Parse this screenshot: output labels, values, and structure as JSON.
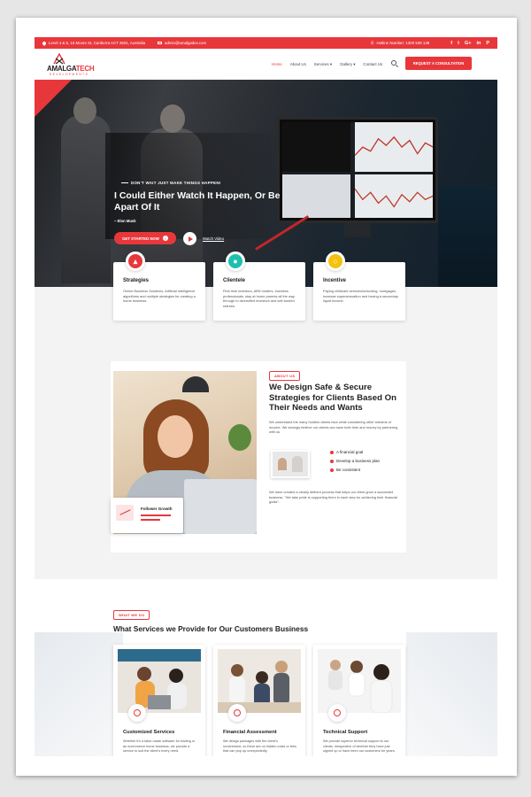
{
  "topbar": {
    "address": "Level 4 & 5, 15 Moore St, Canberra ACT 2601, Australia",
    "email": "admin@amalgadev.com",
    "phone": "Hotline Number: 1300 539 138",
    "social": [
      "f",
      "t",
      "G+",
      "in",
      "P"
    ]
  },
  "logo": {
    "name_a": "AMALGA",
    "name_b": "TECH",
    "sub": "DEVELOPMENTS"
  },
  "nav": {
    "items": [
      "Home",
      "About Us",
      "Services",
      "Gallery",
      "Contact Us"
    ],
    "active": "Home",
    "cta": "REQUEST A CONSULTATION"
  },
  "hero": {
    "tagline": "DON'T WAIT JUST MAKE THINGS HAPPEN!",
    "title": "I Could Either Watch It Happen, Or Be Apart Of It",
    "author": "~ Elon Musk",
    "cta": "GET STARTED NOW",
    "watch": "Watch Video",
    "prev": "‹",
    "next": "›"
  },
  "features": [
    {
      "title": "Strategies",
      "desc": "Online Business Solutions, Artificial intelligence algorithms and multiple strategies for creating a home business.",
      "color": "#e8373b",
      "icon": "chart-icon"
    },
    {
      "title": "Clientele",
      "desc": "First time investors, ABN holders, business professionals, stay at home parents all the way through to diversified investors and self-funded retirees.",
      "color": "#1fbfaf",
      "icon": "piggy-bank-icon"
    },
    {
      "title": "Incentive",
      "desc": "Paying childcare services/schooling, mortgages, increase superannuation and having a secondary liquid income.",
      "color": "#f4c20d",
      "icon": "coins-icon"
    }
  ],
  "about": {
    "badge": "ABOUT US",
    "heading": "We Design Safe & Secure Strategies for Clients Based On Their Needs and Wants",
    "p1": "We understand the many hurdles clients face while considering other streams of income. We strongly believe our clients can save both time and money by partnering with us.",
    "list": [
      "A financial goal",
      "Develop a business plan",
      "Be consistent"
    ],
    "p2": "We have created a clearly defined process that helps our client grow a successful business. \"We take pride is supporting them in each step for achieving their financial goals\".",
    "follower": "Follower Growth"
  },
  "services": {
    "badge": "WHAT WE DO",
    "heading": "What Services we Provide for Our Customers Business",
    "items": [
      {
        "title": "Customized Services",
        "desc": "Whether it's a tailor-made software for trading or an ecommerce home business, we provide a service to suit the client's every need."
      },
      {
        "title": "Financial Assessment",
        "desc": "We design packages with the client's involvement, so there are no hidden costs or fees that can pop up unexpectedly."
      },
      {
        "title": "Technical Support",
        "desc": "We provide superior technical support to our clients, irrespective of whether they have just signed up or have been our customers for years."
      }
    ]
  }
}
